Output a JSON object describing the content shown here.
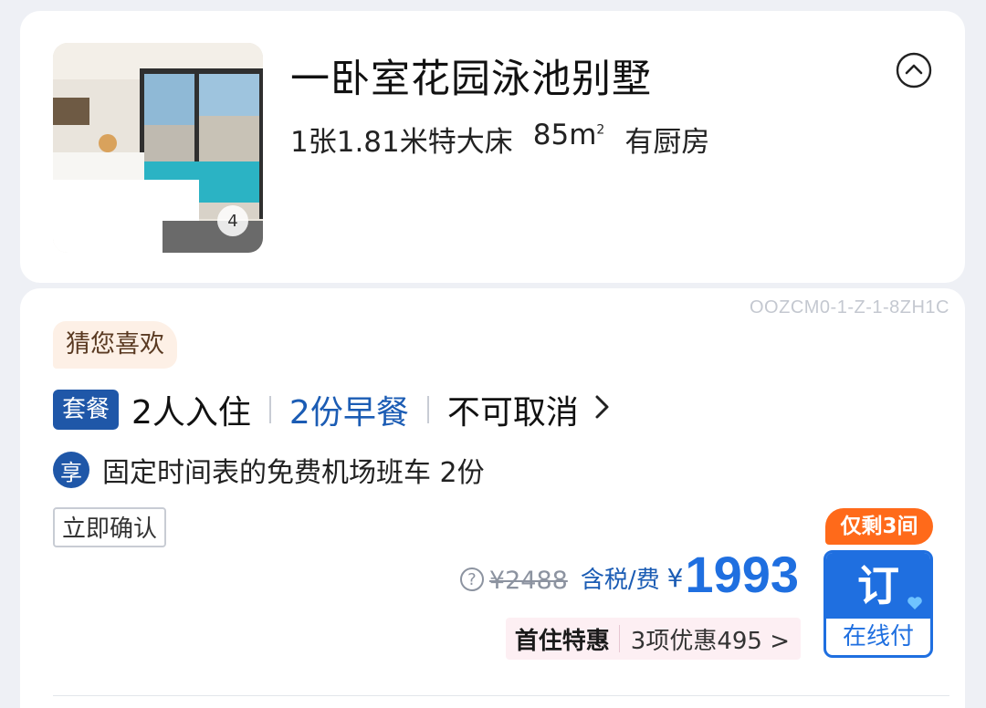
{
  "room": {
    "title": "一卧室花园泳池别墅",
    "photo_count": "4",
    "bed": "1张1.81米特大床",
    "area": "85m",
    "area_sup": "2",
    "kitchen": "有厨房"
  },
  "rate": {
    "code": "OOZCM0-1-Z-1-8ZH1C",
    "guess_tag": "猜您喜欢",
    "package_badge": "套餐",
    "occupancy": "2人入住",
    "breakfast": "2份早餐",
    "cancel_policy": "不可取消",
    "perk_icon": "享",
    "perk_text": "固定时间表的免费机场班车 2份",
    "confirm_tag": "立即确认",
    "original_price": "¥2488",
    "tax_note": "含税/费",
    "currency": "¥",
    "price": "1993",
    "promo_first": "首住特惠",
    "promo_detail": "3项优惠495 >",
    "rooms_left": "仅剩3间",
    "book_label": "订",
    "pay_label": "在线付"
  },
  "colors": {
    "brand_blue": "#1f6fe0",
    "badge_blue": "#1f57a8",
    "orange": "#ff6a1a",
    "promo_pink": "#fdeff3"
  },
  "icons": [
    "collapse-chevron-up-icon",
    "help-question-icon",
    "perk-enjoy-icon",
    "chevron-right-icon",
    "heart-icon"
  ]
}
